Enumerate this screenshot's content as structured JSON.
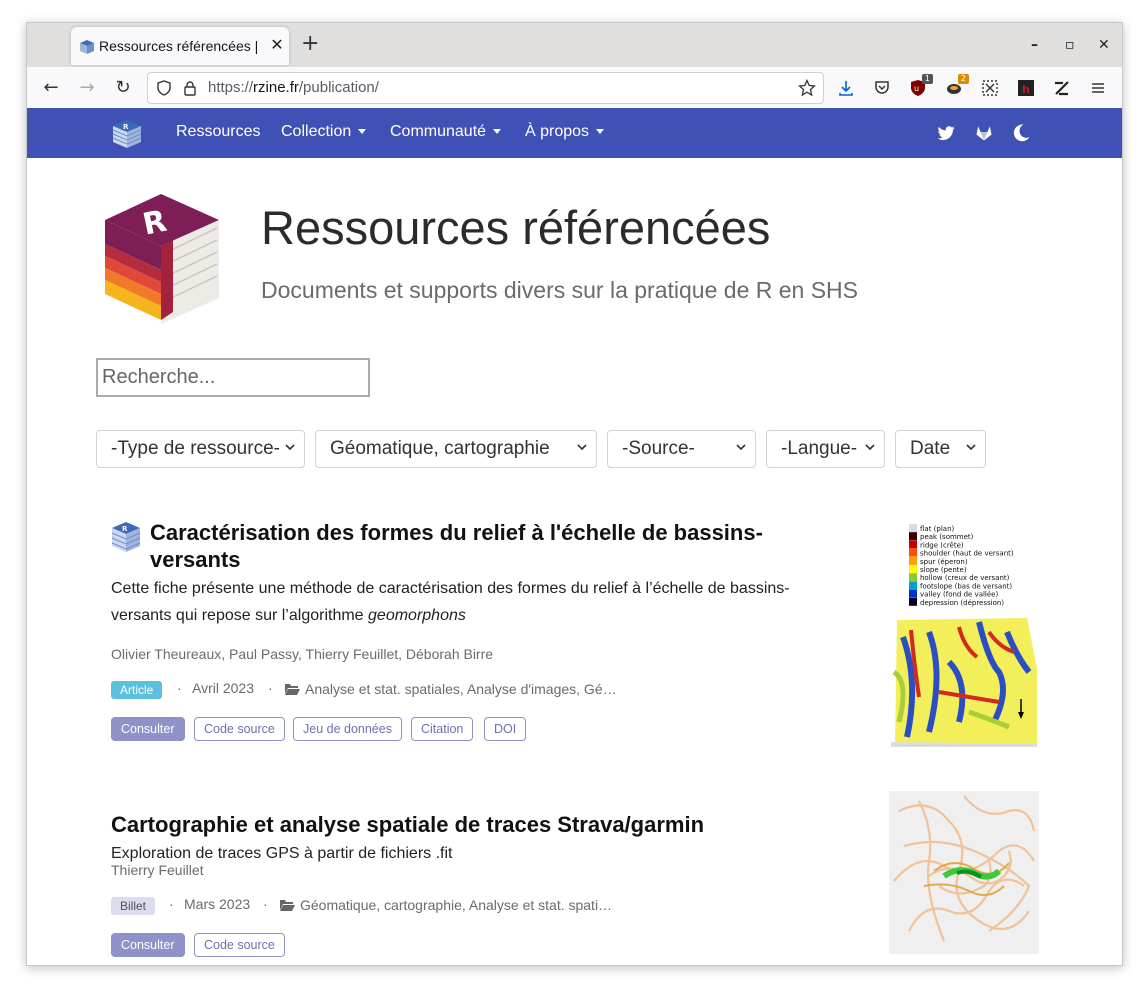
{
  "browser": {
    "tab_title": "Ressources référencées | R",
    "url_scheme": "https://",
    "url_domain": "rzine.fr",
    "url_path": "/publication/",
    "toolbar_badges": [
      "1",
      "2"
    ]
  },
  "site_nav": {
    "menu": [
      "Ressources",
      "Collection",
      "Communauté",
      "À propos"
    ]
  },
  "page": {
    "title": "Ressources référencées",
    "subtitle": "Documents et supports divers sur la pratique de R en SHS",
    "search_placeholder": "Recherche..."
  },
  "filters": [
    {
      "value": "-Type de ressource-"
    },
    {
      "value": "Géomatique, cartographie"
    },
    {
      "value": "-Source-"
    },
    {
      "value": "-Langue-"
    },
    {
      "value": "Date"
    }
  ],
  "publications": [
    {
      "title": "Caractérisation des formes du relief à l'échelle de bassins-versants",
      "summary_pre": "Cette fiche présente une méthode de caractérisation des formes du relief à l’échelle de bassins-versants qui repose sur l’algorithme ",
      "summary_em": "geomorphons",
      "authors": "Olivier Theureaux, Paul Passy, Thierry Feuillet, Déborah Birre",
      "type": "Article",
      "date": "Avril 2023",
      "categories": "Analyse et stat. spatiales, Analyse d'images, Gé…",
      "buttons": [
        "Consulter",
        "Code source",
        "Jeu de données",
        "Citation",
        "DOI"
      ],
      "thumb_legend": [
        {
          "label": "flat (plan)",
          "color": "#dcdcdc"
        },
        {
          "label": "peak (sommet)",
          "color": "#380000"
        },
        {
          "label": "ridge (crête)",
          "color": "#c80000"
        },
        {
          "label": "shoulder (haut de versant)",
          "color": "#ff5000"
        },
        {
          "label": "spur (éperon)",
          "color": "#ffa000"
        },
        {
          "label": "slope (pente)",
          "color": "#ffff00"
        },
        {
          "label": "hollow (creux de versant)",
          "color": "#8cc832"
        },
        {
          "label": "footslope (bas de versant)",
          "color": "#00a0c8"
        },
        {
          "label": "valley (fond de vallée)",
          "color": "#0032c8"
        },
        {
          "label": "depression (dépression)",
          "color": "#000028"
        }
      ]
    },
    {
      "title": "Cartographie et analyse spatiale de traces Strava/garmin",
      "summary_pre": "Exploration de traces GPS à partir de fichiers .fit",
      "summary_em": "",
      "authors": "Thierry Feuillet",
      "type": "Billet",
      "date": "Mars 2023",
      "categories": "Géomatique, cartographie, Analyse et stat. spati…",
      "buttons": [
        "Consulter",
        "Code source"
      ]
    }
  ],
  "colors": {
    "nav_bg": "#3f51b5",
    "article_badge": "#5bc0de",
    "billet_badge": "#dcdcf0",
    "button_primary": "#8e92c8"
  }
}
